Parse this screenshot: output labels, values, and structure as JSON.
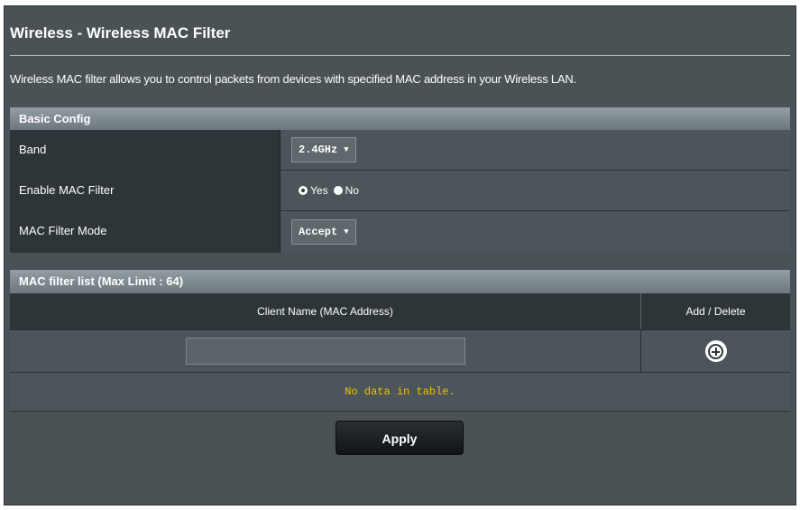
{
  "page": {
    "title": "Wireless - Wireless MAC Filter",
    "description": "Wireless MAC filter allows you to control packets from devices with specified MAC address in your Wireless LAN."
  },
  "basic_config": {
    "header": "Basic Config",
    "band": {
      "label": "Band",
      "value": "2.4GHz"
    },
    "enable_filter": {
      "label": "Enable MAC Filter",
      "options": [
        "Yes",
        "No"
      ],
      "selected": "Yes"
    },
    "filter_mode": {
      "label": "MAC Filter Mode",
      "value": "Accept"
    }
  },
  "mac_list": {
    "header": "MAC filter list (Max Limit : 64)",
    "columns": [
      "Client Name (MAC Address)",
      "Add / Delete"
    ],
    "input_value": "",
    "empty_message": "No data in table."
  },
  "actions": {
    "apply_label": "Apply"
  },
  "colors": {
    "background": "#4b5256",
    "label_cell": "#2e3538",
    "empty_text": "#f0c000"
  }
}
